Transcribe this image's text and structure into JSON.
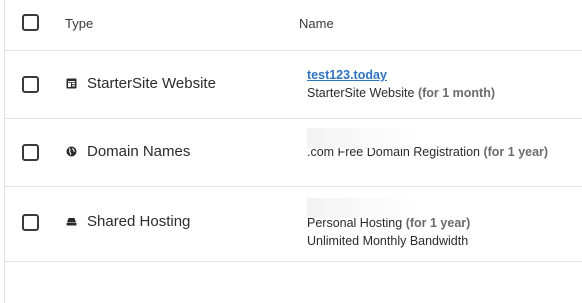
{
  "table": {
    "header": {
      "type_label": "Type",
      "name_label": "Name"
    },
    "rows": [
      {
        "type_label": "StarterSite Website",
        "type_icon": "website-icon",
        "name_link": "test123.today",
        "description": "StarterSite Website",
        "term": "(for 1 month)"
      },
      {
        "type_label": "Domain Names",
        "type_icon": "globe-icon",
        "description": ".com Free Domain Registration",
        "term": "(for 1 year)"
      },
      {
        "type_label": "Shared Hosting",
        "type_icon": "hosting-icon",
        "description": "Personal Hosting",
        "term": "(for 1 year)",
        "extra": "Unlimited Monthly Bandwidth"
      }
    ]
  },
  "colors": {
    "link": "#2f74c0",
    "border": "#e2e2e2",
    "muted": "#6b6b6b"
  }
}
